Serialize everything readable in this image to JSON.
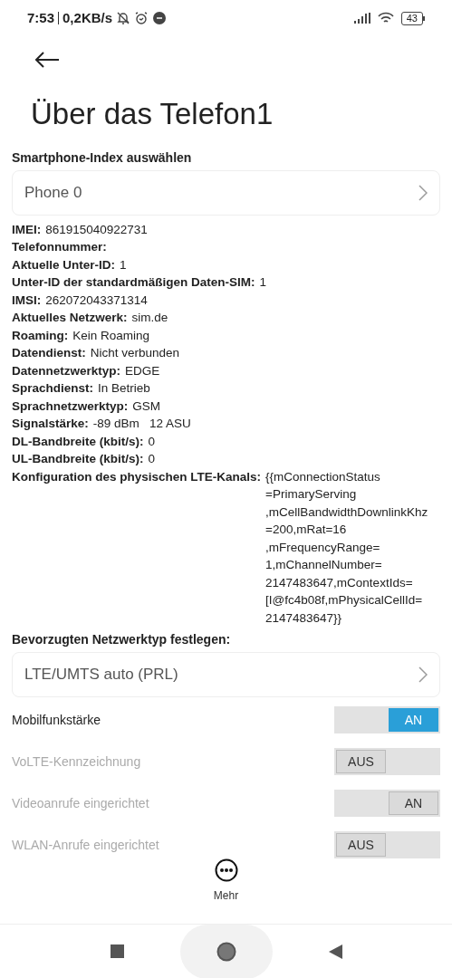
{
  "status_bar": {
    "time": "7:53",
    "speed": "0,2KB/s",
    "battery": "43"
  },
  "title": "Über das Telefon1",
  "phone_index": {
    "label": "Smartphone-Index auswählen",
    "value": "Phone 0"
  },
  "info": [
    {
      "label": "IMEI:",
      "value": "861915040922731"
    },
    {
      "label": "Telefonnummer:"
    },
    {
      "label": "Aktuelle Unter-ID:",
      "value": "1"
    },
    {
      "label": "Unter-ID der standardmäßigen Daten-SIM:",
      "value": "1"
    },
    {
      "label": "IMSI:",
      "value": "262072043371314"
    },
    {
      "label": "Aktuelles Netzwerk:",
      "value": "sim.de"
    },
    {
      "label": "Roaming:",
      "value": "Kein Roaming"
    },
    {
      "label": "Datendienst:",
      "value": "Nicht verbunden"
    },
    {
      "label": "Datennetzwerktyp:",
      "value": "EDGE"
    },
    {
      "label": "Sprachdienst:",
      "value": "In Betrieb"
    },
    {
      "label": "Sprachnetzwerktyp:",
      "value": "GSM"
    },
    {
      "label": "Signalstärke:",
      "value": "-89 dBm   12 ASU"
    },
    {
      "label": "DL-Bandbreite (kbit/s):",
      "value": "0"
    },
    {
      "label": "UL-Bandbreite (kbit/s):",
      "value": "0"
    },
    {
      "label": "Konfiguration des physischen LTE-Kanals:",
      "value": "{{mConnectionStatus =PrimaryServing ,mCellBandwidthDownlinkKhz =200,mRat=16 ,mFrequencyRange= 1,mChannelNumber= 2147483647,mContextIds= [I@fc4b08f,mPhysicalCellId= 2147483647}}"
    }
  ],
  "network_type": {
    "label": "Bevorzugten Netzwerktyp festlegen:",
    "value": "LTE/UMTS auto (PRL)"
  },
  "toggles": [
    {
      "label": "Mobilfunkstärke",
      "state": "AN",
      "on": true,
      "disabled": false
    },
    {
      "label": "VoLTE-Kennzeichnung",
      "state": "AUS",
      "on": false,
      "disabled": true
    },
    {
      "label": "Videoanrufe eingerichtet",
      "state": "AN",
      "on": true,
      "disabled": true
    },
    {
      "label": "WLAN-Anrufe eingerichtet",
      "state": "AUS",
      "on": false,
      "disabled": true
    }
  ],
  "more_button": {
    "label": "Mehr"
  }
}
